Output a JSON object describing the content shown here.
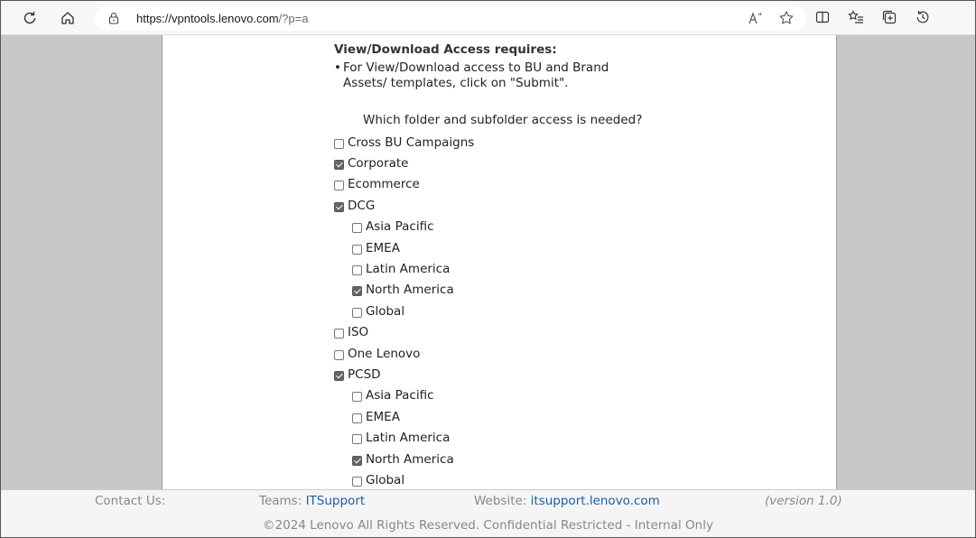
{
  "browser": {
    "url_host": "https://vpntools.lenovo.com",
    "url_path": "/?p=a"
  },
  "section": {
    "heading": "View/Download Access requires:",
    "bullet_line1": "For View/Download access to BU and Brand",
    "bullet_line2": "Assets/ templates, click on \"Submit\".",
    "question": "Which folder and subfolder access is needed?"
  },
  "options": [
    {
      "label": "Cross BU Campaigns",
      "checked": false,
      "level": 0
    },
    {
      "label": "Corporate",
      "checked": true,
      "level": 0
    },
    {
      "label": "Ecommerce",
      "checked": false,
      "level": 0
    },
    {
      "label": "DCG",
      "checked": true,
      "level": 0
    },
    {
      "label": "Asia Pacific",
      "checked": false,
      "level": 1
    },
    {
      "label": "EMEA",
      "checked": false,
      "level": 1
    },
    {
      "label": "Latin America",
      "checked": false,
      "level": 1
    },
    {
      "label": "North America",
      "checked": true,
      "level": 1
    },
    {
      "label": "Global",
      "checked": false,
      "level": 1
    },
    {
      "label": "ISO",
      "checked": false,
      "level": 0
    },
    {
      "label": "One Lenovo",
      "checked": false,
      "level": 0
    },
    {
      "label": "PCSD",
      "checked": true,
      "level": 0
    },
    {
      "label": "Asia Pacific",
      "checked": false,
      "level": 1
    },
    {
      "label": "EMEA",
      "checked": false,
      "level": 1
    },
    {
      "label": "Latin America",
      "checked": false,
      "level": 1
    },
    {
      "label": "North America",
      "checked": true,
      "level": 1
    },
    {
      "label": "Global",
      "checked": false,
      "level": 1
    }
  ],
  "footer": {
    "contact_label": "Contact Us:",
    "teams_label": "Teams: ",
    "teams_link": "ITSupport",
    "website_label": "Website: ",
    "website_link": "itsupport.lenovo.com",
    "version": "(version 1.0)",
    "copyright": "©2024 Lenovo All Rights Reserved. Confidential Restricted - Internal Only"
  }
}
